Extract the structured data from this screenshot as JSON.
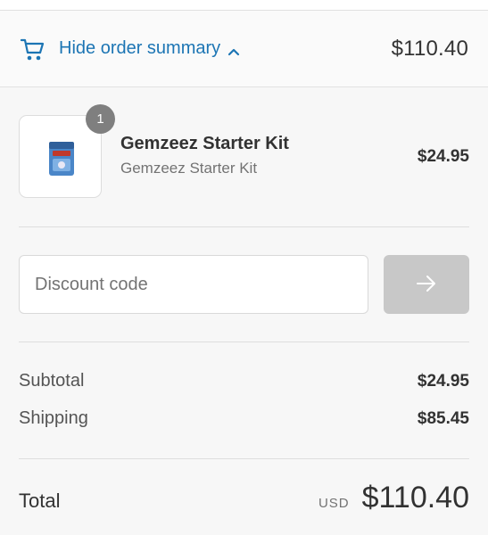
{
  "header": {
    "toggle_label": "Hide order summary",
    "toggle_total": "$110.40",
    "icons": {
      "cart": "cart-icon",
      "chevron": "chevron-up-icon"
    }
  },
  "cart": {
    "items": [
      {
        "name": "Gemzeez Starter Kit",
        "variant": "Gemzeez Starter Kit",
        "price": "$24.95",
        "quantity": "1"
      }
    ]
  },
  "discount": {
    "placeholder": "Discount code",
    "apply_icon": "arrow-right-icon"
  },
  "totals": {
    "subtotal_label": "Subtotal",
    "subtotal_value": "$24.95",
    "shipping_label": "Shipping",
    "shipping_value": "$85.45",
    "total_label": "Total",
    "currency": "USD",
    "total_value": "$110.40"
  },
  "colors": {
    "accent": "#1c75b4",
    "panel_background": "#f7f7f7",
    "button_disabled": "#c8c8c8"
  }
}
